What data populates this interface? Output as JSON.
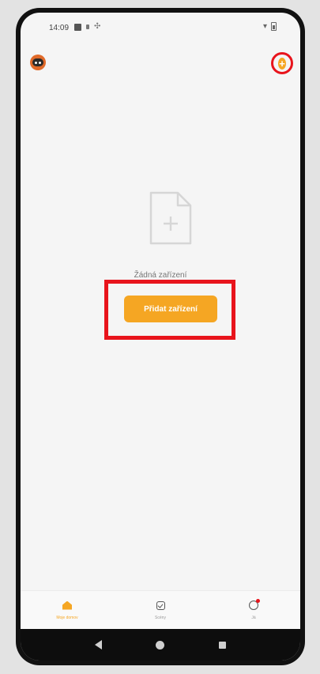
{
  "status_bar": {
    "time": "14:09"
  },
  "header": {
    "avatar_icon": "robot-avatar-icon",
    "add_icon": "plus-circle-icon",
    "accent_color": "#f5a623",
    "highlight_color": "#e8141c"
  },
  "empty_state": {
    "icon": "file-plus-icon",
    "message": "Žádná zařízení",
    "button_label": "Přidat zařízení"
  },
  "tabs": [
    {
      "label": "Moje domov",
      "icon": "home-icon",
      "active": true
    },
    {
      "label": "Scény",
      "icon": "checkbox-icon",
      "active": false
    },
    {
      "label": "Já",
      "icon": "profile-icon",
      "active": false
    }
  ]
}
